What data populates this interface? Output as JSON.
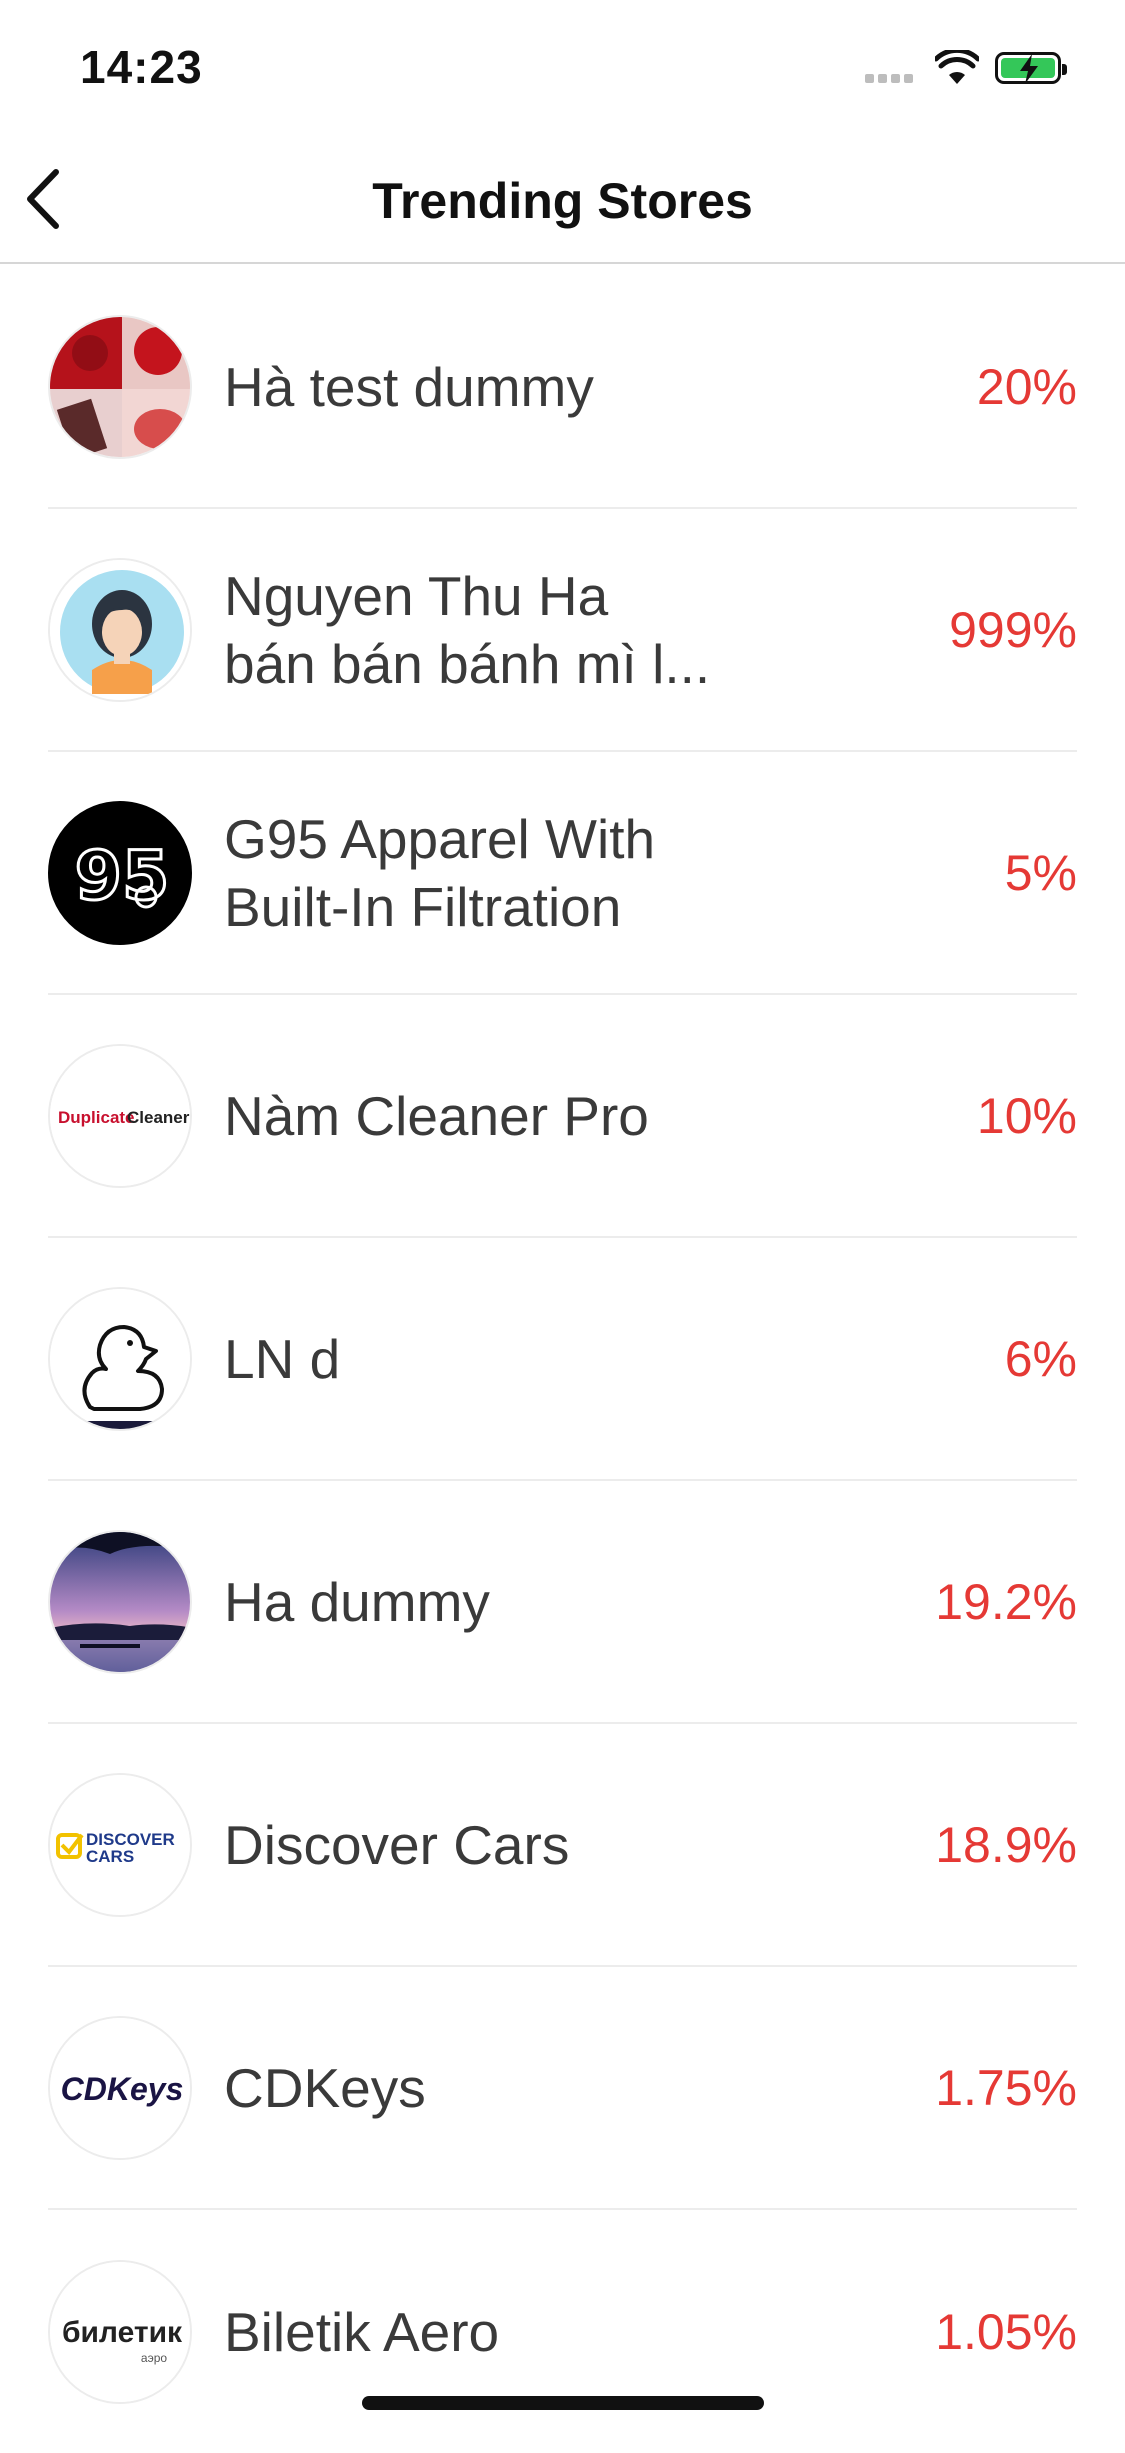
{
  "status_bar": {
    "time": "14:23",
    "icons": [
      "signal-icon",
      "wifi-icon",
      "battery-charging-icon"
    ],
    "battery_color": "#34c759"
  },
  "nav": {
    "title": "Trending Stores",
    "back_icon": "chevron-left-icon"
  },
  "accent_color": "#e53935",
  "stores": [
    {
      "name": "Hà test dummy",
      "rate": "20%"
    },
    {
      "name": "Nguyen Thu Ha\nbán bán bánh mì l...",
      "rate": "999%"
    },
    {
      "name": "G95 Apparel With\nBuilt-In Filtration",
      "rate": "5%",
      "logo_text": "95"
    },
    {
      "name": "Nàm Cleaner Pro",
      "rate": "10%",
      "logo_text_a": "Duplicate",
      "logo_text_b": "Cleaner"
    },
    {
      "name": "LN d",
      "rate": "6%"
    },
    {
      "name": "Ha dummy",
      "rate": "19.2%"
    },
    {
      "name": "Discover Cars",
      "rate": "18.9%",
      "logo_text_a": "DISCOVER",
      "logo_text_b": "CARS"
    },
    {
      "name": "CDKeys",
      "rate": "1.75%",
      "logo_text": "CDKeys"
    },
    {
      "name": "Biletik Aero",
      "rate": "1.05%",
      "logo_text": "билетик",
      "logo_sub": "аэро"
    }
  ]
}
